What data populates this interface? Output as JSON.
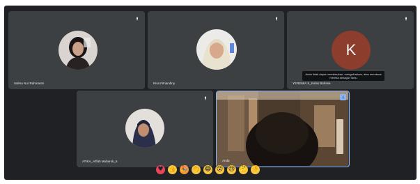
{
  "participants": [
    {
      "name": "Salma Nur Rahmanto"
    },
    {
      "name": "Nisa Fitriandiny"
    },
    {
      "name": "YEREMIA S_Kelas Bahasa",
      "avatar_letter": "K",
      "avatar_color": "#8c3d2b"
    },
    {
      "name": "ATIKA_Afifah Mubarok_6"
    },
    {
      "name": "Anda"
    }
  ],
  "tooltip": {
    "text": "Anda tidak dapat membisukan, mengeluarkan, atau membuat mereka sebagai Tamu"
  },
  "reactions": [
    {
      "icon": "heart-icon",
      "glyph": "♥",
      "color": "#e8455a"
    },
    {
      "icon": "thumbs-up-icon",
      "glyph": "👍",
      "color": "#f6c644"
    },
    {
      "icon": "party-popper-icon",
      "glyph": "🎉",
      "color": "#f29b38"
    },
    {
      "icon": "clapping-hands-icon",
      "glyph": "👏",
      "color": "#f6c644"
    },
    {
      "icon": "laughing-face-icon",
      "glyph": "😂",
      "color": "#f6c644"
    },
    {
      "icon": "surprised-face-icon",
      "glyph": "😮",
      "color": "#f6c644"
    },
    {
      "icon": "sad-face-icon",
      "glyph": "😢",
      "color": "#f6c644"
    },
    {
      "icon": "thinking-face-icon",
      "glyph": "🤔",
      "color": "#f6c644"
    },
    {
      "icon": "thumbs-down-icon",
      "glyph": "👎",
      "color": "#f6c644"
    }
  ]
}
